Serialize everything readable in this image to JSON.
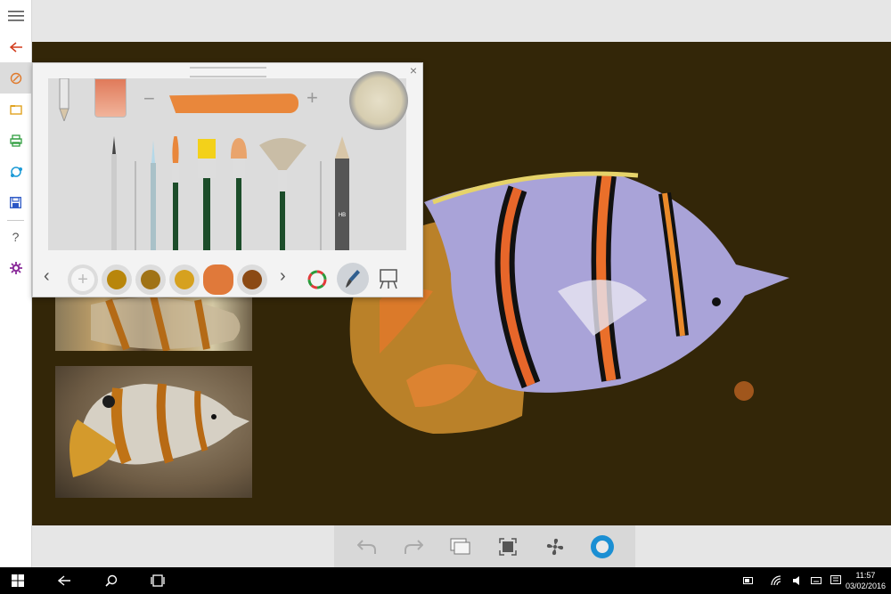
{
  "sidebar": {
    "items": [
      {
        "name": "menu",
        "icon": "hamburger-icon"
      },
      {
        "name": "back",
        "icon": "back-arrow-icon"
      },
      {
        "name": "new",
        "icon": "new-drawing-icon"
      },
      {
        "name": "open",
        "icon": "folder-icon"
      },
      {
        "name": "print",
        "icon": "printer-icon"
      },
      {
        "name": "share",
        "icon": "share-icon"
      },
      {
        "name": "save",
        "icon": "save-icon"
      },
      {
        "name": "help",
        "icon": "help-icon",
        "label": "?"
      },
      {
        "name": "settings",
        "icon": "gear-icon"
      }
    ]
  },
  "palette": {
    "close_label": "×",
    "minus_label": "−",
    "plus_label": "+",
    "tools": [
      "pencil",
      "liner-brush",
      "detail-brush",
      "round-brush",
      "flat-brush",
      "filbert-brush",
      "fan-brush",
      "graphite-pencil"
    ],
    "pencil_label": "HB",
    "swatch_colors": [
      "#b8860b",
      "#a07316",
      "#d6a11f",
      "#e0793a",
      "#8b4a14"
    ],
    "current_color": "#e9873b",
    "nav_prev": "‹",
    "nav_next": "›"
  },
  "bottom_toolbar": {
    "buttons": [
      "undo-icon",
      "redo-icon",
      "layers-icon",
      "fit-screen-icon",
      "fan-icon",
      "color-picker-icon"
    ]
  },
  "taskbar": {
    "time": "11:57",
    "date": "03/02/2016"
  },
  "colors": {
    "canvas": "#332608",
    "sidebar_accent": "#d23c1c"
  }
}
